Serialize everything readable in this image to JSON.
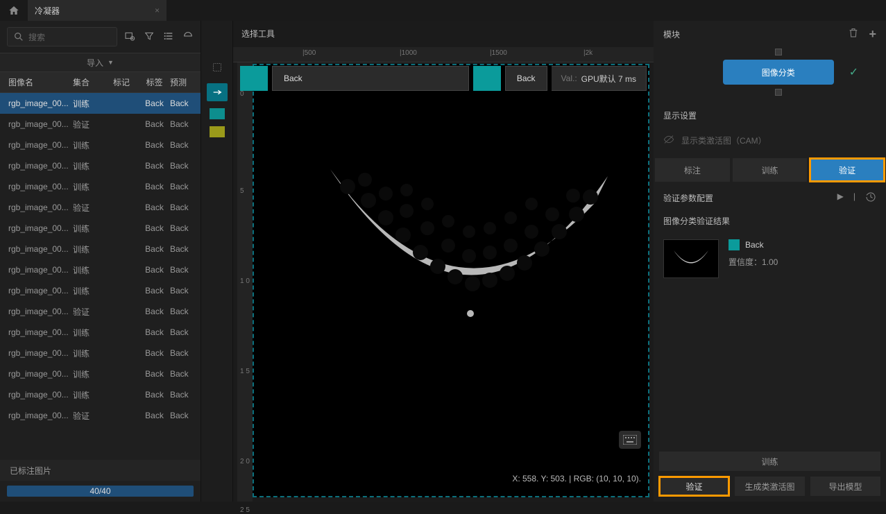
{
  "titlebar": {
    "tab_name": "冷凝器"
  },
  "sidebar": {
    "search_placeholder": "搜索",
    "import_label": "导入",
    "columns": {
      "name": "图像名",
      "set": "集合",
      "mark": "标记",
      "label": "标签",
      "pred": "预测"
    },
    "rows": [
      {
        "name": "rgb_image_00...",
        "set": "训练",
        "label": "Back",
        "pred": "Back",
        "sel": true
      },
      {
        "name": "rgb_image_00...",
        "set": "验证",
        "label": "Back",
        "pred": "Back"
      },
      {
        "name": "rgb_image_00...",
        "set": "训练",
        "label": "Back",
        "pred": "Back"
      },
      {
        "name": "rgb_image_00...",
        "set": "训练",
        "label": "Back",
        "pred": "Back"
      },
      {
        "name": "rgb_image_00...",
        "set": "训练",
        "label": "Back",
        "pred": "Back"
      },
      {
        "name": "rgb_image_00...",
        "set": "验证",
        "label": "Back",
        "pred": "Back"
      },
      {
        "name": "rgb_image_00...",
        "set": "训练",
        "label": "Back",
        "pred": "Back"
      },
      {
        "name": "rgb_image_00...",
        "set": "训练",
        "label": "Back",
        "pred": "Back"
      },
      {
        "name": "rgb_image_00...",
        "set": "训练",
        "label": "Back",
        "pred": "Back"
      },
      {
        "name": "rgb_image_00...",
        "set": "训练",
        "label": "Back",
        "pred": "Back"
      },
      {
        "name": "rgb_image_00...",
        "set": "验证",
        "label": "Back",
        "pred": "Back"
      },
      {
        "name": "rgb_image_00...",
        "set": "训练",
        "label": "Back",
        "pred": "Back"
      },
      {
        "name": "rgb_image_00...",
        "set": "训练",
        "label": "Back",
        "pred": "Back"
      },
      {
        "name": "rgb_image_00...",
        "set": "训练",
        "label": "Back",
        "pred": "Back"
      },
      {
        "name": "rgb_image_00...",
        "set": "训练",
        "label": "Back",
        "pred": "Back"
      },
      {
        "name": "rgb_image_00...",
        "set": "验证",
        "label": "Back",
        "pred": "Back"
      }
    ],
    "summary": "已标注图片",
    "progress": "40/40"
  },
  "center": {
    "header": "选择工具",
    "ticks_h": [
      "|500",
      "|1000",
      "|1500",
      "|2k"
    ],
    "ticks_v": [
      "0",
      "5",
      "1 0",
      "1 5",
      "2 0",
      "2 5"
    ],
    "chip1": "Back",
    "chip2": "Back",
    "val_prefix": "Val.:",
    "val_text": "GPU默认 7 ms",
    "coord": "X: 558. Y: 503. | RGB: (10, 10, 10)."
  },
  "right": {
    "header": "模块",
    "module": "图像分类",
    "display_settings": "显示设置",
    "cam_label": "显示类激活图（CAM）",
    "tabs": {
      "label": "标注",
      "train": "训练",
      "validate": "验证"
    },
    "param_title": "验证参数配置",
    "result_title": "图像分类验证结果",
    "result_label": "Back",
    "confidence": "置信度：1.00",
    "train_btn": "训练",
    "validate_btn": "验证",
    "cam_btn": "生成类激活图",
    "export_btn": "导出模型"
  }
}
